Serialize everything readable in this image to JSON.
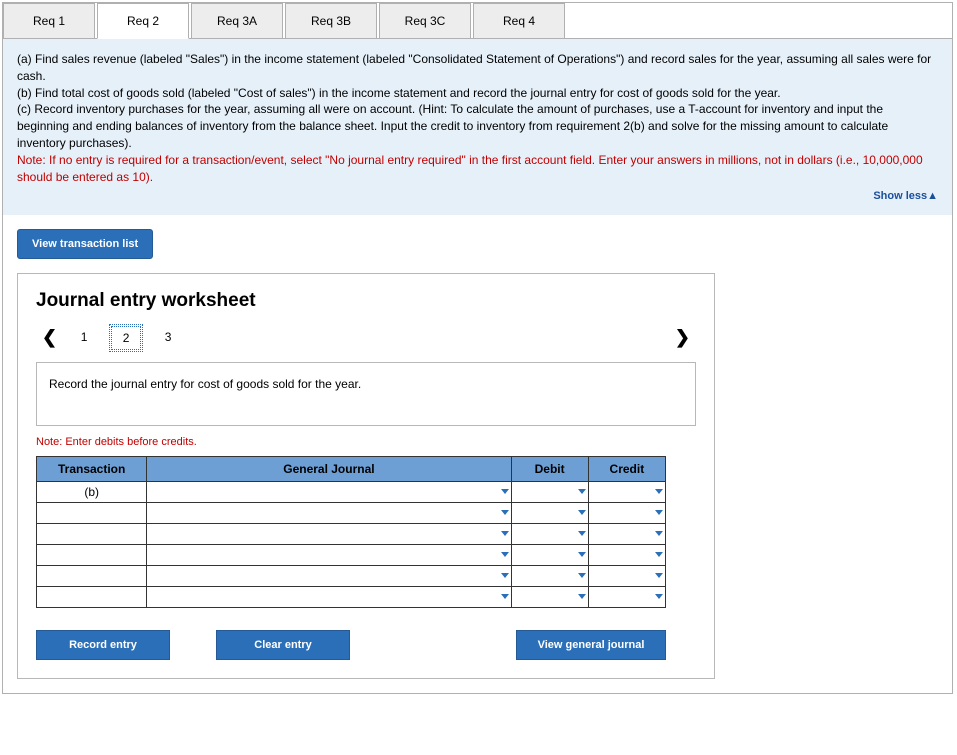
{
  "tabs": [
    "Req 1",
    "Req 2",
    "Req 3A",
    "Req 3B",
    "Req 3C",
    "Req 4"
  ],
  "active_tab_index": 1,
  "instructions": {
    "a": "(a) Find sales revenue (labeled \"Sales\") in the income statement (labeled \"Consolidated Statement of Operations\") and record sales for the year, assuming all sales were for cash.",
    "b": "(b) Find total cost of goods sold (labeled \"Cost of sales\") in the income statement and record the journal entry for cost of goods sold for the year.",
    "c": "(c) Record inventory purchases for the year, assuming all were on account. (Hint: To calculate the amount of purchases, use a T-account for inventory and input the beginning and ending balances of inventory from the balance sheet. Input the credit to inventory from requirement 2(b) and solve for the missing amount to calculate inventory purchases).",
    "note": "Note: If no entry is required for a transaction/event, select \"No journal entry required\" in the first account field. Enter your answers in millions, not in dollars (i.e., 10,000,000 should be entered as 10)."
  },
  "show_less": "Show less",
  "view_trans_list": "View transaction list",
  "worksheet": {
    "title": "Journal entry worksheet",
    "steps": [
      "1",
      "2",
      "3"
    ],
    "selected_step_index": 1,
    "prompt": "Record the journal entry for cost of goods sold for the year.",
    "credit_note": "Note: Enter debits before credits.",
    "headers": {
      "transaction": "Transaction",
      "gj": "General Journal",
      "debit": "Debit",
      "credit": "Credit"
    },
    "rows": [
      {
        "trans": "(b)",
        "gj": "",
        "debit": "",
        "credit": ""
      },
      {
        "trans": "",
        "gj": "",
        "debit": "",
        "credit": ""
      },
      {
        "trans": "",
        "gj": "",
        "debit": "",
        "credit": ""
      },
      {
        "trans": "",
        "gj": "",
        "debit": "",
        "credit": ""
      },
      {
        "trans": "",
        "gj": "",
        "debit": "",
        "credit": ""
      },
      {
        "trans": "",
        "gj": "",
        "debit": "",
        "credit": ""
      }
    ],
    "buttons": {
      "record": "Record entry",
      "clear": "Clear entry",
      "view_gj": "View general journal"
    }
  }
}
